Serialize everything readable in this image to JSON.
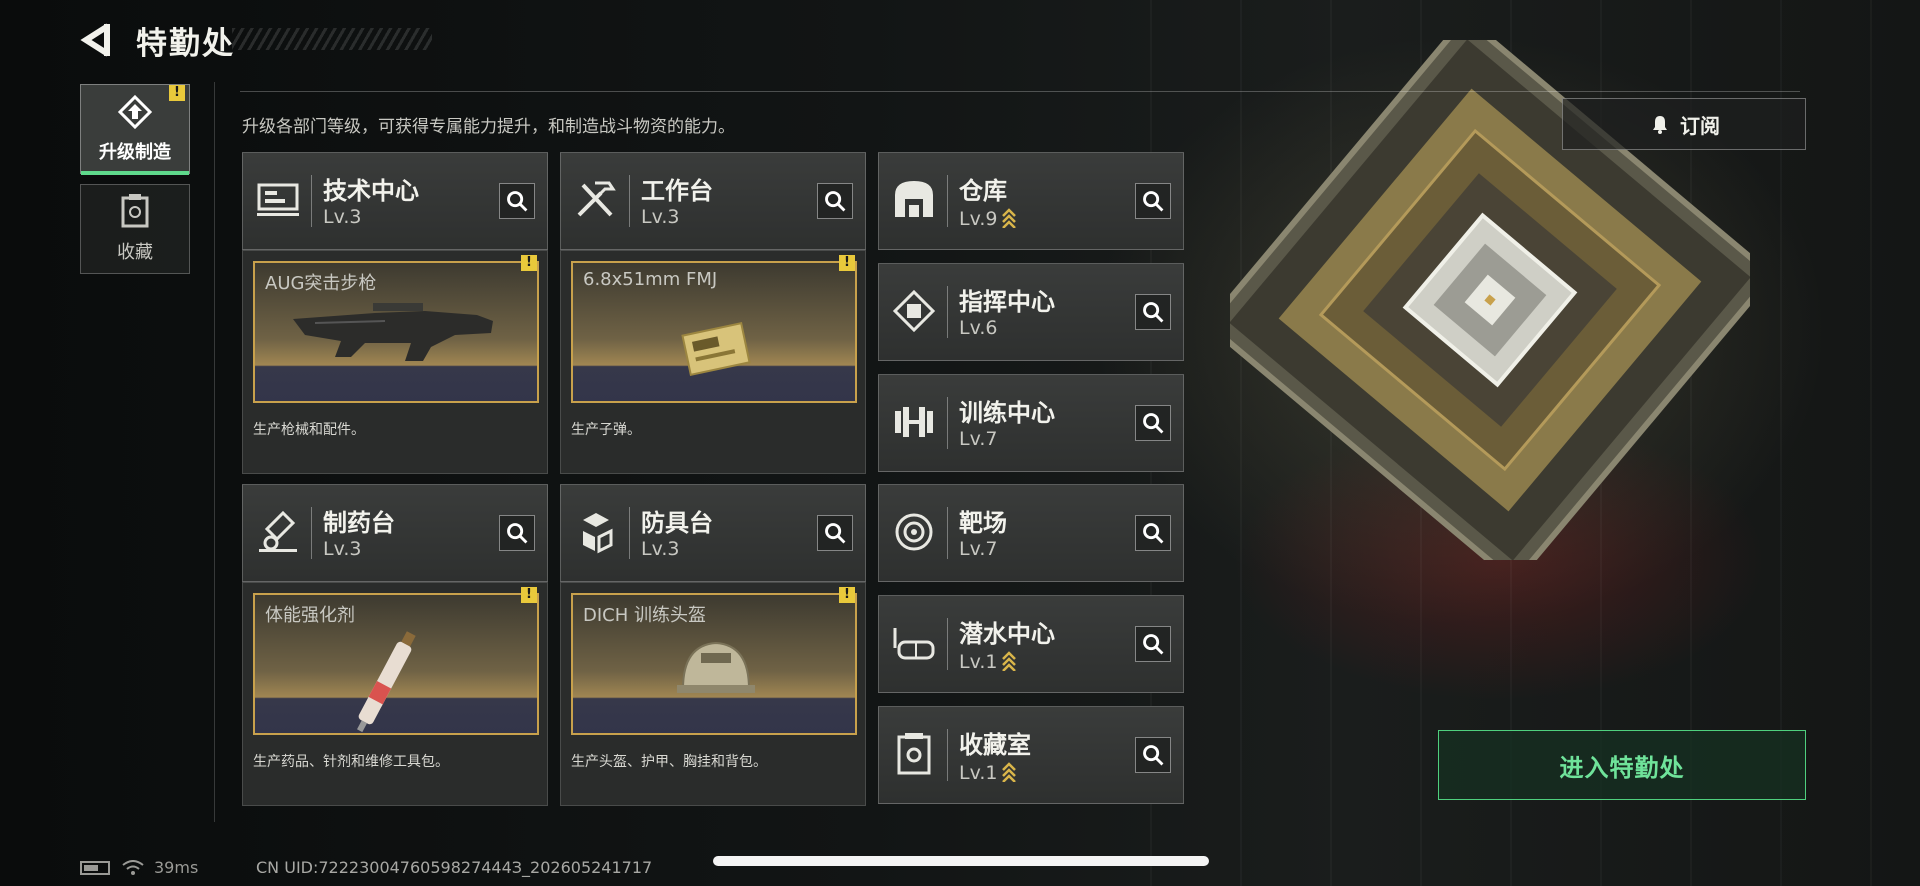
{
  "header": {
    "title": "特勤处",
    "subtitle": "升级各部门等级，可获得专属能力提升，和制造战斗物资的能力。"
  },
  "nav": [
    {
      "label": "升级制造",
      "icon": "upgrade-icon",
      "active": true,
      "alert": "!"
    },
    {
      "label": "收藏",
      "icon": "collection-icon",
      "active": false
    }
  ],
  "departments": [
    {
      "name": "技术中心",
      "level": "Lv.3",
      "icon": "tech-center-icon"
    },
    {
      "name": "工作台",
      "level": "Lv.3",
      "icon": "workbench-icon"
    },
    {
      "name": "仓库",
      "level": "Lv.9",
      "icon": "warehouse-icon"
    },
    {
      "name": "指挥中心",
      "level": "Lv.6",
      "icon": "command-center-icon"
    },
    {
      "name": "训练中心",
      "level": "Lv.7",
      "icon": "training-center-icon"
    },
    {
      "name": "制药台",
      "level": "Lv.3",
      "icon": "pharmacy-icon"
    },
    {
      "name": "防具台",
      "level": "Lv.3",
      "icon": "armor-bench-icon"
    },
    {
      "name": "靶场",
      "level": "Lv.7",
      "icon": "shooting-range-icon"
    },
    {
      "name": "潜水中心",
      "level": "Lv.1",
      "icon": "diving-center-icon"
    },
    {
      "name": "收藏室",
      "level": "Lv.1",
      "icon": "collection-room-icon"
    }
  ],
  "production": [
    {
      "item": "AUG突击步枪",
      "desc": "生产枪械和配件。",
      "alert": "!",
      "icon": "rifle-icon"
    },
    {
      "item": "6.8x51mm FMJ",
      "desc": "生产子弹。",
      "alert": "!",
      "icon": "ammo-box-icon"
    },
    {
      "item": "体能强化剂",
      "desc": "生产药品、针剂和维修工具包。",
      "alert": "!",
      "icon": "injector-icon"
    },
    {
      "item": "DICH 训练头盔",
      "desc": "生产头盔、护甲、胸挂和背包。",
      "alert": "!",
      "icon": "helmet-icon"
    }
  ],
  "right": {
    "subscribe_label": "订阅",
    "enter_label": "进入特勤处"
  },
  "status_bar": {
    "ping": "39ms",
    "uid": "CN UID:7222300476059827444З_202605241717"
  },
  "colors": {
    "accent_green": "#5fd98c",
    "gold": "#c8a14c",
    "alert_yellow": "#e9c93b"
  }
}
